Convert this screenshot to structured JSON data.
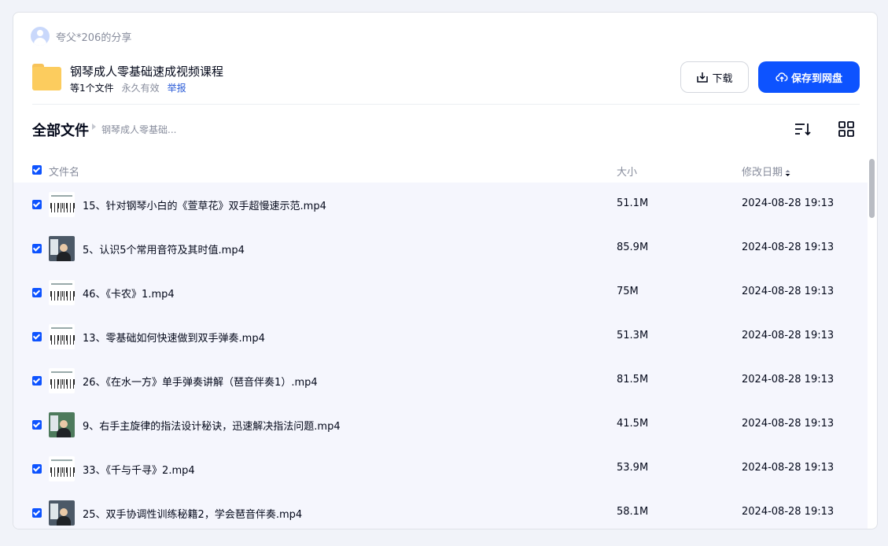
{
  "sharer": {
    "text": "夸父*206的分享"
  },
  "share": {
    "title": "钢琴成人零基础速成视频课程",
    "count": "等1个文件",
    "validity": "永久有效",
    "report": "举报"
  },
  "actions": {
    "download_label": "下载",
    "save_label": "保存到网盘"
  },
  "breadcrumb": {
    "root": "全部文件",
    "current": "钢琴成人零基础..."
  },
  "table": {
    "columns": {
      "name": "文件名",
      "size": "大小",
      "date": "修改日期"
    },
    "rows": [
      {
        "name": "15、针对钢琴小白的《萱草花》双手超慢速示范.mp4",
        "size": "51.1M",
        "date": "2024-08-28 19:13",
        "thumb": "piano-keys"
      },
      {
        "name": "5、认识5个常用音符及其时值.mp4",
        "size": "85.9M",
        "date": "2024-08-28 19:13",
        "thumb": "teacher"
      },
      {
        "name": "46、《卡农》1.mp4",
        "size": "75M",
        "date": "2024-08-28 19:13",
        "thumb": "piano-keys"
      },
      {
        "name": "13、零基础如何快速做到双手弹奏.mp4",
        "size": "51.3M",
        "date": "2024-08-28 19:13",
        "thumb": "piano-keys"
      },
      {
        "name": "26、《在水一方》单手弹奏讲解（琶音伴奏1）.mp4",
        "size": "81.5M",
        "date": "2024-08-28 19:13",
        "thumb": "piano-keys"
      },
      {
        "name": "9、右手主旋律的指法设计秘诀，迅速解决指法问题.mp4",
        "size": "41.5M",
        "date": "2024-08-28 19:13",
        "thumb": "teacher-green"
      },
      {
        "name": "33、《千与千寻》2.mp4",
        "size": "53.9M",
        "date": "2024-08-28 19:13",
        "thumb": "piano-keys"
      },
      {
        "name": "25、双手协调性训练秘籍2，学会琶音伴奏.mp4",
        "size": "58.1M",
        "date": "2024-08-28 19:13",
        "thumb": "teacher"
      }
    ]
  },
  "colors": {
    "accent": "#0d53ff",
    "row_selected_bg": "#f5f6fd"
  }
}
